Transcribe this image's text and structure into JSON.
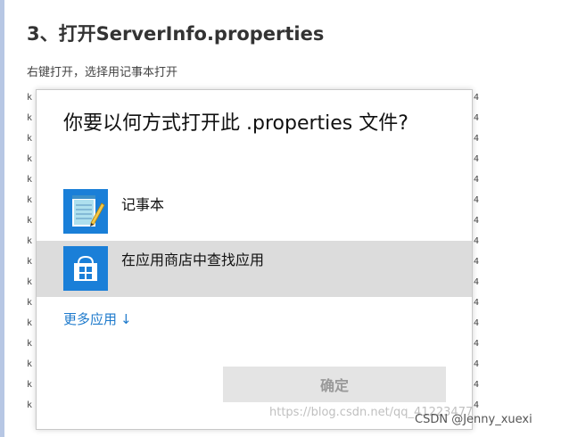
{
  "article": {
    "heading": "3、打开ServerInfo.properties",
    "instruction": "右键打开，选择用记事本打开"
  },
  "background_listing": {
    "left_glyphs": [
      "k",
      "k",
      "k",
      "k",
      "k",
      "k",
      "k",
      "k",
      "k",
      "k",
      "k",
      "k",
      "k",
      "k",
      "k",
      "k"
    ],
    "right_glyphs": [
      "4",
      "4",
      "4",
      "4",
      "4",
      "4",
      "4",
      "4",
      "4",
      "4",
      "4",
      "4",
      "4",
      "4",
      "4",
      "4"
    ]
  },
  "dialog": {
    "title": "你要以何方式打开此 .properties 文件?",
    "apps": [
      {
        "label": "记事本",
        "icon": "notepad-icon",
        "selected": false
      },
      {
        "label": "在应用商店中查找应用",
        "icon": "store-icon",
        "selected": true
      }
    ],
    "more_apps_label": "更多应用",
    "more_apps_arrow": "↓",
    "ok_label": "确定"
  },
  "watermark": {
    "url": "https://blog.csdn.net/qq_41223477",
    "credit": "CSDN @Jenny_xuexi"
  },
  "colors": {
    "accent": "#1a7fd8",
    "link": "#1e7acc",
    "selected_row": "#dcdcdc",
    "disabled_button": "#e4e4e4"
  }
}
